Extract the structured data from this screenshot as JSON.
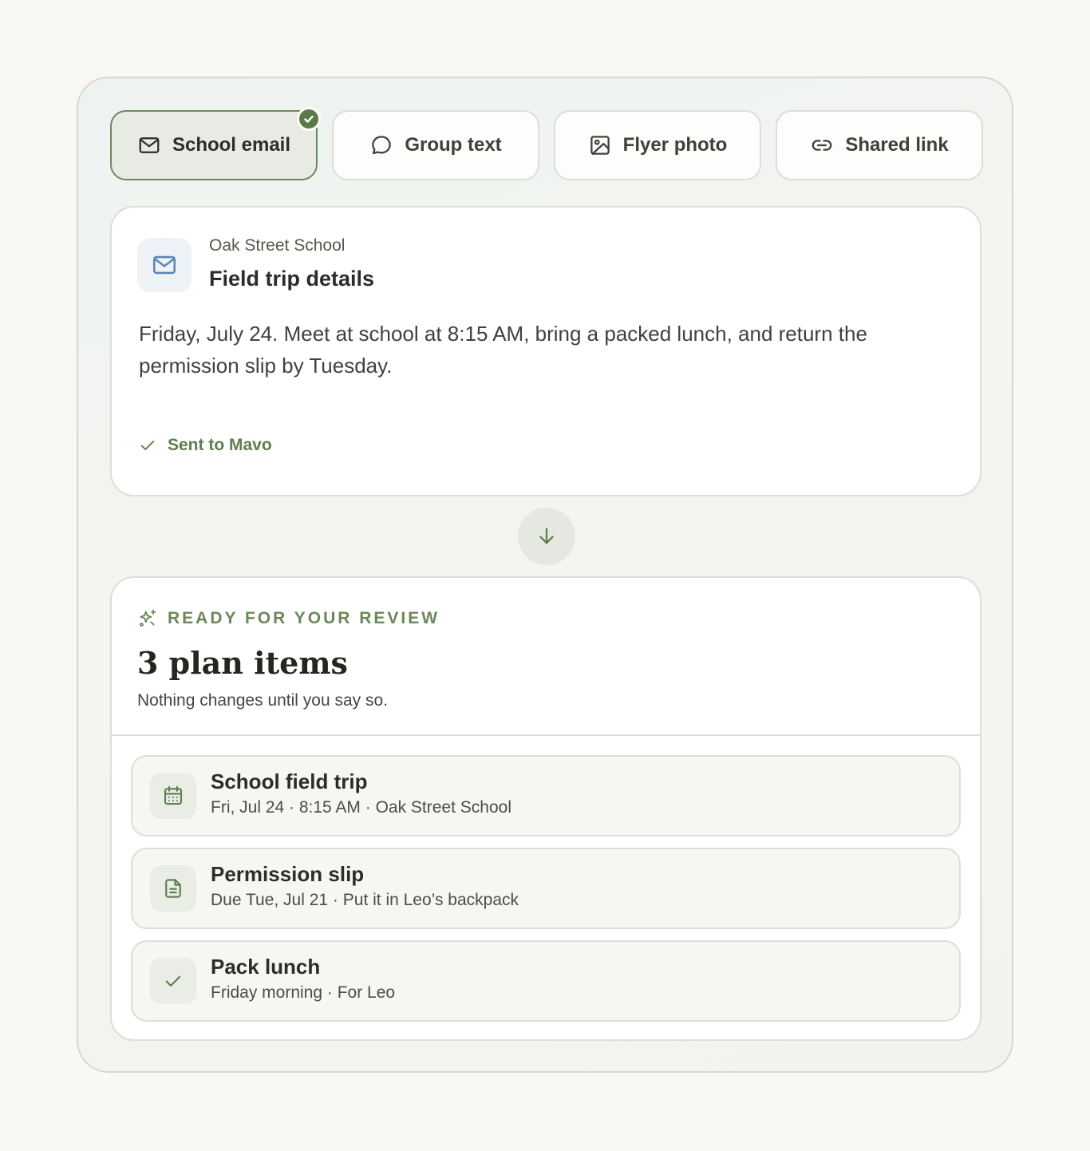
{
  "sources": [
    {
      "label": "School email",
      "icon": "mail-icon",
      "selected": true
    },
    {
      "label": "Group text",
      "icon": "chat-bubble-icon",
      "selected": false
    },
    {
      "label": "Flyer photo",
      "icon": "image-icon",
      "selected": false
    },
    {
      "label": "Shared link",
      "icon": "link-icon",
      "selected": false
    }
  ],
  "message": {
    "sender": "Oak Street School",
    "subject": "Field trip details",
    "body": "Friday, July 24. Meet at school at 8:15 AM, bring a packed lunch, and return the permission slip by Tuesday.",
    "status": "Sent to Mavo"
  },
  "plan": {
    "eyebrow": "READY FOR YOUR REVIEW",
    "title": "3 plan items",
    "subtitle": "Nothing changes until you say so.",
    "items": [
      {
        "title": "School field trip",
        "meta": "Fri, Jul 24 · 8:15 AM · Oak Street School",
        "icon": "calendar-icon"
      },
      {
        "title": "Permission slip",
        "meta": "Due Tue, Jul 21 · Put it in Leo’s backpack",
        "icon": "document-icon"
      },
      {
        "title": "Pack lunch",
        "meta": "Friday morning · For Leo",
        "icon": "check-icon"
      }
    ]
  },
  "colors": {
    "accent": "#5a7b45",
    "page_background": "#faf8f3",
    "card_background": "#ffffff",
    "selected_tab": "#e8ebe3"
  }
}
